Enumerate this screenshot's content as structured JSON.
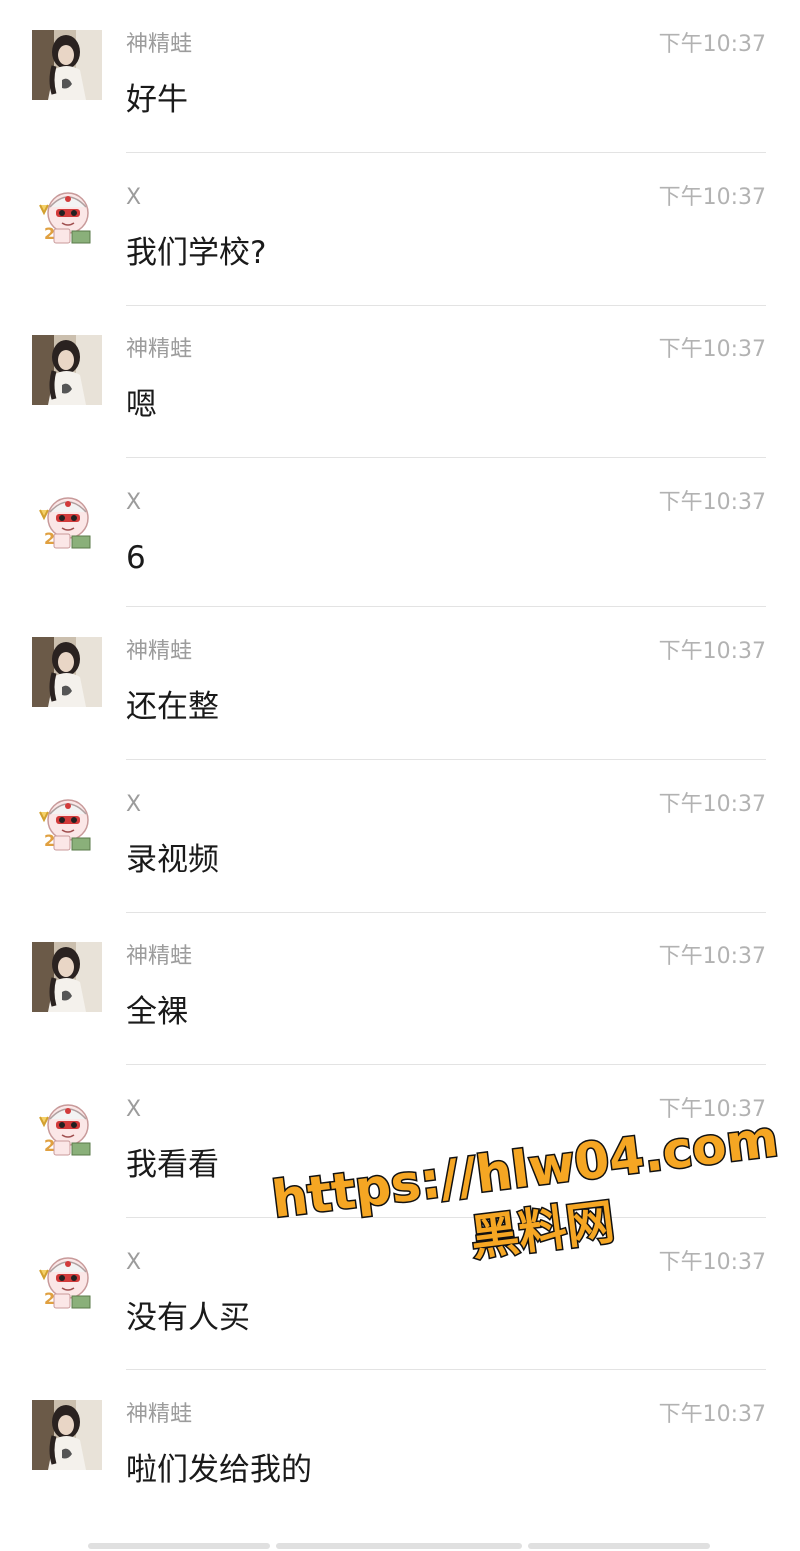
{
  "messages": [
    {
      "sender": "神精蛙",
      "avatar": "photo-avatar-icon",
      "time": "下午10:37",
      "text": "好牛"
    },
    {
      "sender": "X",
      "avatar": "cartoon-avatar-icon",
      "time": "下午10:37",
      "text": "我们学校?"
    },
    {
      "sender": "神精蛙",
      "avatar": "photo-avatar-icon",
      "time": "下午10:37",
      "text": "嗯"
    },
    {
      "sender": "X",
      "avatar": "cartoon-avatar-icon",
      "time": "下午10:37",
      "text": "6"
    },
    {
      "sender": "神精蛙",
      "avatar": "photo-avatar-icon",
      "time": "下午10:37",
      "text": "还在整"
    },
    {
      "sender": "X",
      "avatar": "cartoon-avatar-icon",
      "time": "下午10:37",
      "text": "录视频"
    },
    {
      "sender": "神精蛙",
      "avatar": "photo-avatar-icon",
      "time": "下午10:37",
      "text": "全裸"
    },
    {
      "sender": "X",
      "avatar": "cartoon-avatar-icon",
      "time": "下午10:37",
      "text": "我看看"
    },
    {
      "sender": "X",
      "avatar": "cartoon-avatar-icon",
      "time": "下午10:37",
      "text": "没有人买"
    },
    {
      "sender": "神精蛙",
      "avatar": "photo-avatar-icon",
      "time": "下午10:37",
      "text": "啦们发给我的"
    }
  ],
  "watermark": {
    "url": "https://hlw04.com",
    "label": "黑料网",
    "fill_color": "#f5a623",
    "outline_color": "#111111"
  }
}
